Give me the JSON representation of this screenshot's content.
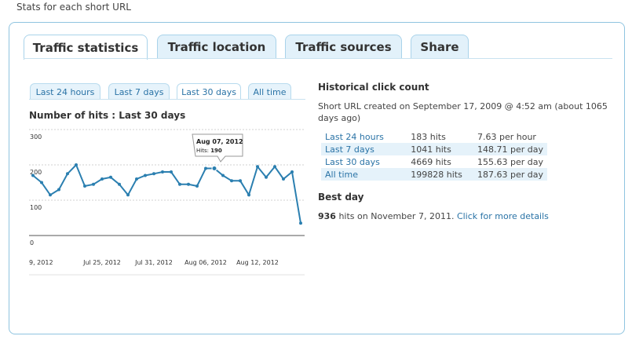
{
  "page": {
    "header": "Stats for each short URL"
  },
  "tabs": [
    {
      "label": "Traffic statistics",
      "active": true
    },
    {
      "label": "Traffic location",
      "active": false
    },
    {
      "label": "Traffic sources",
      "active": false
    },
    {
      "label": "Share",
      "active": false
    }
  ],
  "sub_tabs": [
    {
      "label": "Last 24 hours",
      "active": false
    },
    {
      "label": "Last 7 days",
      "active": false
    },
    {
      "label": "Last 30 days",
      "active": true
    },
    {
      "label": "All time",
      "active": false
    }
  ],
  "chart": {
    "title": "Number of hits : Last 30 days"
  },
  "chart_data": {
    "type": "line",
    "title": "Number of hits : Last 30 days",
    "ylim": [
      0,
      300
    ],
    "yticks": [
      "0",
      "100",
      "200",
      "300"
    ],
    "xtick_labels": [
      "9, 2012",
      "Jul 25, 2012",
      "Jul 31, 2012",
      "Aug 06, 2012",
      "Aug 12, 2012"
    ],
    "xtick_index": [
      2,
      8,
      14,
      20,
      26
    ],
    "grid": true,
    "series": [
      {
        "values": [
          170,
          150,
          115,
          130,
          175,
          200,
          140,
          145,
          160,
          165,
          145,
          115,
          160,
          170,
          175,
          180,
          180,
          145,
          145,
          140,
          190,
          190,
          170,
          155,
          155,
          115,
          195,
          165,
          195,
          160,
          180,
          35
        ]
      }
    ],
    "tooltip": {
      "date": "Aug 07, 2012",
      "label": "Hits:",
      "value": "190",
      "index": 21
    },
    "line_color": "#2b7fb0"
  },
  "historical": {
    "title": "Historical click count",
    "created": "Short URL created on September 17, 2009 @ 4:52 am (about 1065 days ago)",
    "rows": [
      {
        "period": "Last 24 hours",
        "hits": "183 hits",
        "rate": "7.63 per hour"
      },
      {
        "period": "Last 7 days",
        "hits": "1041 hits",
        "rate": "148.71 per day"
      },
      {
        "period": "Last 30 days",
        "hits": "4669 hits",
        "rate": "155.63 per day"
      },
      {
        "period": "All time",
        "hits": "199828 hits",
        "rate": "187.63 per day"
      }
    ]
  },
  "best_day": {
    "title": "Best day",
    "count": "936",
    "text": " hits on November 7, 2011. ",
    "link": "Click for more details"
  }
}
